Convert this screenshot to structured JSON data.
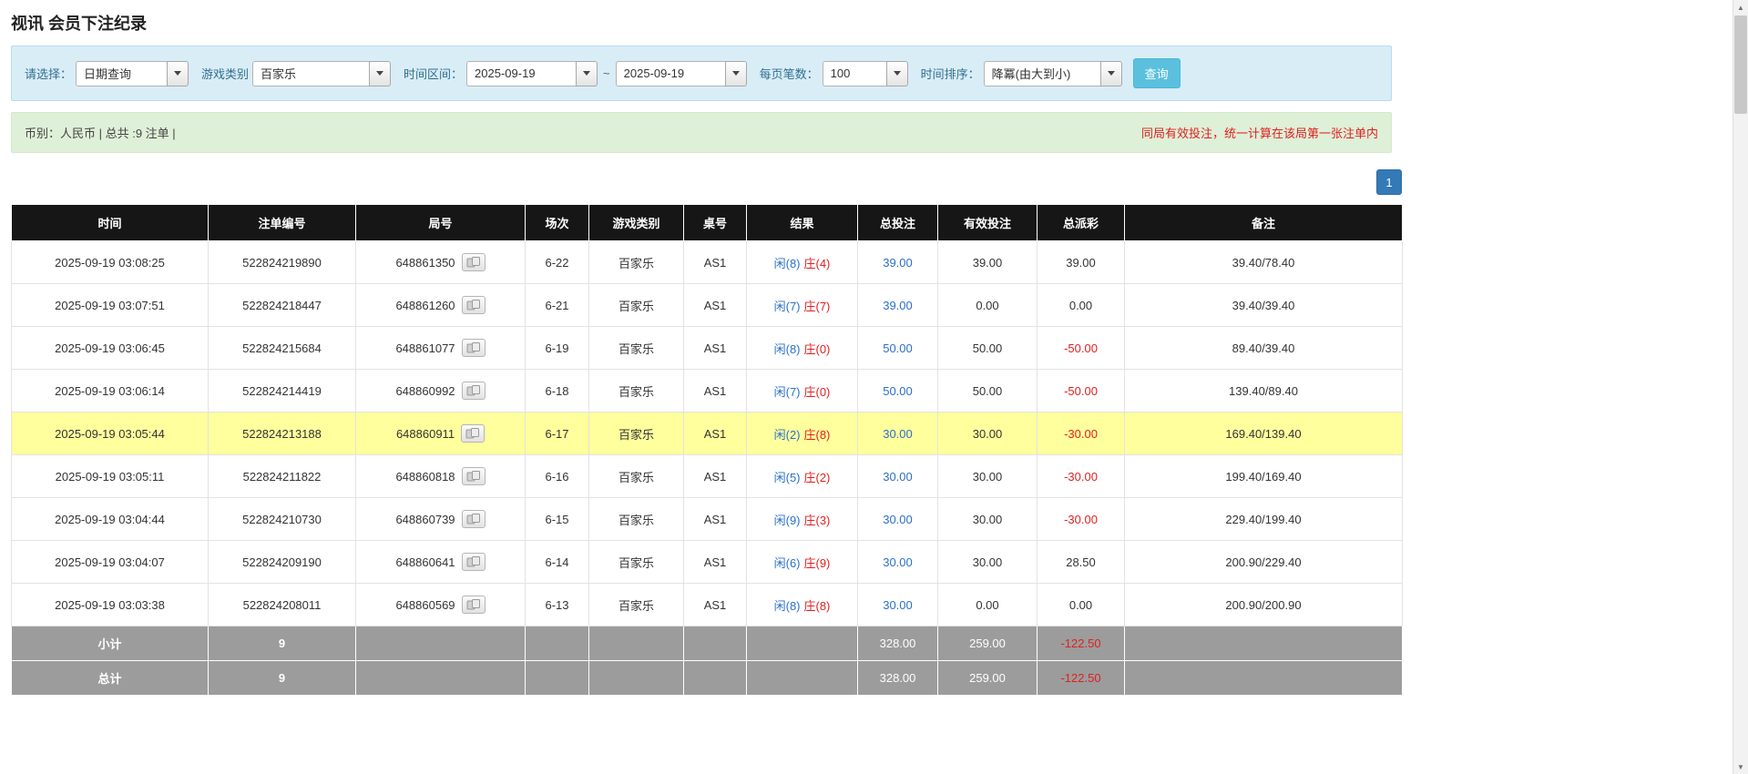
{
  "page": {
    "title": "视讯 会员下注纪录"
  },
  "colors": {
    "accent": "#337ab7",
    "filter_bg": "#d9edf7",
    "filter_border": "#b7dcef",
    "filter_label": "#31708f",
    "query_btn": "#5bc0de",
    "query_btn_border": "#46b8da",
    "summary_bg": "#dff0d8",
    "summary_border": "#d6e9c6",
    "header_bg": "#161616",
    "footer_bg": "#9c9c9c",
    "highlight": "#ffff9d",
    "player_blue": "#2a6fc9",
    "negative": "#e02020"
  },
  "filters": {
    "select_label": "请选择：",
    "select_value": "日期查询",
    "game_type_label": "游戏类别",
    "game_type_value": "百家乐",
    "time_range_label": "时间区间：",
    "date_from": "2025-09-19",
    "range_separator": "~",
    "date_to": "2025-09-19",
    "page_size_label": "每页笔数：",
    "page_size_value": "100",
    "sort_label": "时间排序：",
    "sort_value": "降冪(由大到小)",
    "query_button": "查询"
  },
  "summary": {
    "left_text": "币别：人民币 | 总共 :9 注单 |",
    "right_notice": "同局有效投注，统一计算在该局第一张注单内"
  },
  "pagination": {
    "current_page": "1"
  },
  "icons": {
    "dropdown": "caret-down-icon",
    "round_result": "cards-icon",
    "scroll_up": "▲",
    "scroll_down": "▼"
  },
  "table": {
    "headers": [
      "时间",
      "注单编号",
      "局号",
      "场次",
      "游戏类别",
      "桌号",
      "结果",
      "总投注",
      "有效投注",
      "总派彩",
      "备注"
    ],
    "rows": [
      {
        "time": "2025-09-19 03:08:25",
        "bet_id": "522824219890",
        "round_no": "648861350",
        "session": "6-22",
        "game": "百家乐",
        "table_no": "AS1",
        "result_player": "闲(8)",
        "result_banker": "庄(4)",
        "total_bet": "39.00",
        "valid_bet": "39.00",
        "payout": "39.00",
        "note": "39.40/78.40",
        "highlight": false
      },
      {
        "time": "2025-09-19 03:07:51",
        "bet_id": "522824218447",
        "round_no": "648861260",
        "session": "6-21",
        "game": "百家乐",
        "table_no": "AS1",
        "result_player": "闲(7)",
        "result_banker": "庄(7)",
        "total_bet": "39.00",
        "valid_bet": "0.00",
        "payout": "0.00",
        "note": "39.40/39.40",
        "highlight": false
      },
      {
        "time": "2025-09-19 03:06:45",
        "bet_id": "522824215684",
        "round_no": "648861077",
        "session": "6-19",
        "game": "百家乐",
        "table_no": "AS1",
        "result_player": "闲(8)",
        "result_banker": "庄(0)",
        "total_bet": "50.00",
        "valid_bet": "50.00",
        "payout": "-50.00",
        "note": "89.40/39.40",
        "highlight": false
      },
      {
        "time": "2025-09-19 03:06:14",
        "bet_id": "522824214419",
        "round_no": "648860992",
        "session": "6-18",
        "game": "百家乐",
        "table_no": "AS1",
        "result_player": "闲(7)",
        "result_banker": "庄(0)",
        "total_bet": "50.00",
        "valid_bet": "50.00",
        "payout": "-50.00",
        "note": "139.40/89.40",
        "highlight": false
      },
      {
        "time": "2025-09-19 03:05:44",
        "bet_id": "522824213188",
        "round_no": "648860911",
        "session": "6-17",
        "game": "百家乐",
        "table_no": "AS1",
        "result_player": "闲(2)",
        "result_banker": "庄(8)",
        "total_bet": "30.00",
        "valid_bet": "30.00",
        "payout": "-30.00",
        "note": "169.40/139.40",
        "highlight": true
      },
      {
        "time": "2025-09-19 03:05:11",
        "bet_id": "522824211822",
        "round_no": "648860818",
        "session": "6-16",
        "game": "百家乐",
        "table_no": "AS1",
        "result_player": "闲(5)",
        "result_banker": "庄(2)",
        "total_bet": "30.00",
        "valid_bet": "30.00",
        "payout": "-30.00",
        "note": "199.40/169.40",
        "highlight": false
      },
      {
        "time": "2025-09-19 03:04:44",
        "bet_id": "522824210730",
        "round_no": "648860739",
        "session": "6-15",
        "game": "百家乐",
        "table_no": "AS1",
        "result_player": "闲(9)",
        "result_banker": "庄(3)",
        "total_bet": "30.00",
        "valid_bet": "30.00",
        "payout": "-30.00",
        "note": "229.40/199.40",
        "highlight": false
      },
      {
        "time": "2025-09-19 03:04:07",
        "bet_id": "522824209190",
        "round_no": "648860641",
        "session": "6-14",
        "game": "百家乐",
        "table_no": "AS1",
        "result_player": "闲(6)",
        "result_banker": "庄(9)",
        "total_bet": "30.00",
        "valid_bet": "30.00",
        "payout": "28.50",
        "note": "200.90/229.40",
        "highlight": false
      },
      {
        "time": "2025-09-19 03:03:38",
        "bet_id": "522824208011",
        "round_no": "648860569",
        "session": "6-13",
        "game": "百家乐",
        "table_no": "AS1",
        "result_player": "闲(8)",
        "result_banker": "庄(8)",
        "total_bet": "30.00",
        "valid_bet": "0.00",
        "payout": "0.00",
        "note": "200.90/200.90",
        "highlight": false
      }
    ],
    "subtotal": {
      "label": "小计",
      "count": "9",
      "total_bet": "328.00",
      "valid_bet": "259.00",
      "payout": "-122.50"
    },
    "total": {
      "label": "总计",
      "count": "9",
      "total_bet": "328.00",
      "valid_bet": "259.00",
      "payout": "-122.50"
    }
  }
}
